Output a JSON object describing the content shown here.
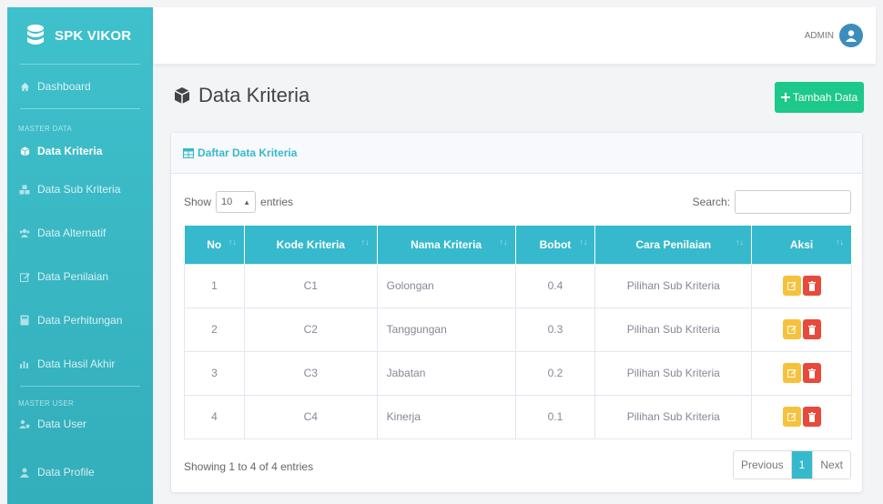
{
  "brand": {
    "name": "SPK VIKOR"
  },
  "sidebar": {
    "items": [
      {
        "label": "Dashboard",
        "icon": "home-icon"
      },
      {
        "label": "Data Kriteria",
        "icon": "cube-icon",
        "active": true
      },
      {
        "label": "Data Sub Kriteria",
        "icon": "cubes-icon"
      },
      {
        "label": "Data Alternatif",
        "icon": "users-icon"
      },
      {
        "label": "Data Penilaian",
        "icon": "edit-icon"
      },
      {
        "label": "Data Perhitungan",
        "icon": "calculator-icon"
      },
      {
        "label": "Data Hasil Akhir",
        "icon": "chart-icon"
      },
      {
        "label": "Data User",
        "icon": "users-cog-icon"
      },
      {
        "label": "Data Profile",
        "icon": "user-icon"
      }
    ],
    "section_master_data": "MASTER DATA",
    "section_master_user": "MASTER USER"
  },
  "topbar": {
    "user_name": "ADMIN"
  },
  "page": {
    "title": "Data Kriteria",
    "add_button": "Tambah Data"
  },
  "card": {
    "title": "Daftar Data Kriteria",
    "show_label": "Show",
    "entries_label": "entries",
    "page_size": "10",
    "search_label": "Search:",
    "search_value": "",
    "columns": [
      "No",
      "Kode Kriteria",
      "Nama Kriteria",
      "Bobot",
      "Cara Penilaian",
      "Aksi"
    ],
    "rows": [
      {
        "no": "1",
        "kode": "C1",
        "nama": "Golongan",
        "bobot": "0.4",
        "cara": "Pilihan Sub Kriteria"
      },
      {
        "no": "2",
        "kode": "C2",
        "nama": "Tanggungan",
        "bobot": "0.3",
        "cara": "Pilihan Sub Kriteria"
      },
      {
        "no": "3",
        "kode": "C3",
        "nama": "Jabatan",
        "bobot": "0.2",
        "cara": "Pilihan Sub Kriteria"
      },
      {
        "no": "4",
        "kode": "C4",
        "nama": "Kinerja",
        "bobot": "0.1",
        "cara": "Pilihan Sub Kriteria"
      }
    ],
    "info": "Showing 1 to 4 of 4 entries",
    "pagination": {
      "previous": "Previous",
      "current": "1",
      "next": "Next"
    }
  },
  "colors": {
    "sidebar": "#3fc1cc",
    "primary": "#36b9cc",
    "success": "#1cc88a",
    "warning": "#f6c23e",
    "danger": "#e74a3b"
  }
}
